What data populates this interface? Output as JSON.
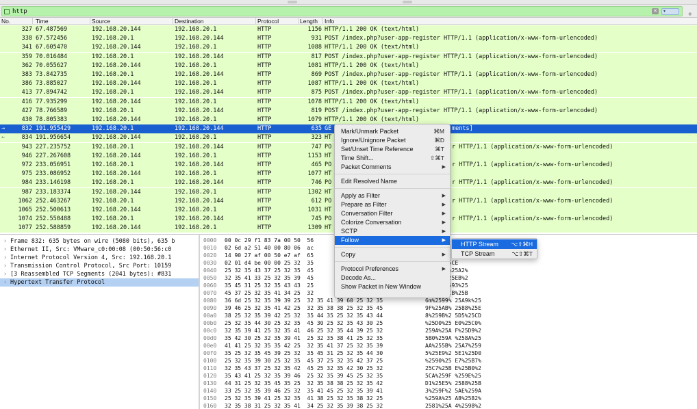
{
  "filter": {
    "value": "http",
    "apply_label": "▾",
    "add_label": "+",
    "clear_label": "✕"
  },
  "columns": [
    "No.",
    "Time",
    "Source",
    "Destination",
    "Protocol",
    "Length",
    "Info"
  ],
  "packets": [
    {
      "mark": "",
      "no": "327",
      "time": "67.487569",
      "src": "192.168.20.144",
      "dst": "192.168.20.1",
      "proto": "HTTP",
      "len": "1156",
      "info": "HTTP/1.1 200 OK  (text/html)"
    },
    {
      "mark": "",
      "no": "338",
      "time": "67.572456",
      "src": "192.168.20.1",
      "dst": "192.168.20.144",
      "proto": "HTTP",
      "len": "931",
      "info": "POST /index.php?user-app-register HTTP/1.1  (application/x-www-form-urlencoded)"
    },
    {
      "mark": "",
      "no": "341",
      "time": "67.605470",
      "src": "192.168.20.144",
      "dst": "192.168.20.1",
      "proto": "HTTP",
      "len": "1088",
      "info": "HTTP/1.1 200 OK  (text/html)"
    },
    {
      "mark": "",
      "no": "359",
      "time": "70.016484",
      "src": "192.168.20.1",
      "dst": "192.168.20.144",
      "proto": "HTTP",
      "len": "817",
      "info": "POST /index.php?user-app-register HTTP/1.1  (application/x-www-form-urlencoded)"
    },
    {
      "mark": "",
      "no": "362",
      "time": "70.055627",
      "src": "192.168.20.144",
      "dst": "192.168.20.1",
      "proto": "HTTP",
      "len": "1081",
      "info": "HTTP/1.1 200 OK  (text/html)"
    },
    {
      "mark": "",
      "no": "383",
      "time": "73.842735",
      "src": "192.168.20.1",
      "dst": "192.168.20.144",
      "proto": "HTTP",
      "len": "869",
      "info": "POST /index.php?user-app-register HTTP/1.1  (application/x-www-form-urlencoded)"
    },
    {
      "mark": "",
      "no": "386",
      "time": "73.885027",
      "src": "192.168.20.144",
      "dst": "192.168.20.1",
      "proto": "HTTP",
      "len": "1087",
      "info": "HTTP/1.1 200 OK  (text/html)"
    },
    {
      "mark": "",
      "no": "413",
      "time": "77.894742",
      "src": "192.168.20.1",
      "dst": "192.168.20.144",
      "proto": "HTTP",
      "len": "875",
      "info": "POST /index.php?user-app-register HTTP/1.1  (application/x-www-form-urlencoded)"
    },
    {
      "mark": "",
      "no": "416",
      "time": "77.935299",
      "src": "192.168.20.144",
      "dst": "192.168.20.1",
      "proto": "HTTP",
      "len": "1078",
      "info": "HTTP/1.1 200 OK  (text/html)"
    },
    {
      "mark": "",
      "no": "427",
      "time": "78.766589",
      "src": "192.168.20.1",
      "dst": "192.168.20.144",
      "proto": "HTTP",
      "len": "819",
      "info": "POST /index.php?user-app-register HTTP/1.1  (application/x-www-form-urlencoded)"
    },
    {
      "mark": "",
      "no": "430",
      "time": "78.805383",
      "src": "192.168.20.144",
      "dst": "192.168.20.1",
      "proto": "HTTP",
      "len": "1079",
      "info": "HTTP/1.1 200 OK  (text/html)"
    },
    {
      "mark": "→",
      "no": "832",
      "time": "191.955429",
      "src": "192.168.20.1",
      "dst": "192.168.20.144",
      "proto": "HTTP",
      "len": "635",
      "info": "GE",
      "info_tail": "ments]",
      "selected": true
    },
    {
      "mark": "←",
      "no": "834",
      "time": "191.956654",
      "src": "192.168.20.144",
      "dst": "192.168.20.1",
      "proto": "HTTP",
      "len": "323",
      "info": "HT"
    },
    {
      "mark": "",
      "no": "943",
      "time": "227.235752",
      "src": "192.168.20.1",
      "dst": "192.168.20.144",
      "proto": "HTTP",
      "len": "747",
      "info": "PO",
      "info_tail": "r HTTP/1.1  (application/x-www-form-urlencoded)"
    },
    {
      "mark": "",
      "no": "946",
      "time": "227.267608",
      "src": "192.168.20.144",
      "dst": "192.168.20.1",
      "proto": "HTTP",
      "len": "1153",
      "info": "HT"
    },
    {
      "mark": "",
      "no": "972",
      "time": "233.056951",
      "src": "192.168.20.1",
      "dst": "192.168.20.144",
      "proto": "HTTP",
      "len": "465",
      "info": "PO",
      "info_tail": "r HTTP/1.1  (application/x-www-form-urlencoded)"
    },
    {
      "mark": "",
      "no": "975",
      "time": "233.086952",
      "src": "192.168.20.144",
      "dst": "192.168.20.1",
      "proto": "HTTP",
      "len": "1077",
      "info": "HT"
    },
    {
      "mark": "",
      "no": "984",
      "time": "233.146198",
      "src": "192.168.20.1",
      "dst": "192.168.20.144",
      "proto": "HTTP",
      "len": "746",
      "info": "PO",
      "info_tail": "r HTTP/1.1  (application/x-www-form-urlencoded)"
    },
    {
      "mark": "",
      "no": "987",
      "time": "233.183374",
      "src": "192.168.20.144",
      "dst": "192.168.20.1",
      "proto": "HTTP",
      "len": "1302",
      "info": "HT"
    },
    {
      "mark": "",
      "no": "1062",
      "time": "252.463267",
      "src": "192.168.20.1",
      "dst": "192.168.20.144",
      "proto": "HTTP",
      "len": "612",
      "info": "PO",
      "info_tail": "r HTTP/1.1  (application/x-www-form-urlencoded)"
    },
    {
      "mark": "",
      "no": "1065",
      "time": "252.500613",
      "src": "192.168.20.144",
      "dst": "192.168.20.1",
      "proto": "HTTP",
      "len": "1031",
      "info": "HT"
    },
    {
      "mark": "",
      "no": "1074",
      "time": "252.550488",
      "src": "192.168.20.1",
      "dst": "192.168.20.144",
      "proto": "HTTP",
      "len": "745",
      "info": "PO",
      "info_tail": "r HTTP/1.1  (application/x-www-form-urlencoded)"
    },
    {
      "mark": "",
      "no": "1077",
      "time": "252.588859",
      "src": "192.168.20.144",
      "dst": "192.168.20.1",
      "proto": "HTTP",
      "len": "1309",
      "info": "HT"
    }
  ],
  "details": [
    {
      "text": "Frame 832: 635 bytes on wire (5080 bits), 635 b"
    },
    {
      "text": "Ethernet II, Src: VMware_c0:00:08 (00:50:56:c0"
    },
    {
      "text": "Internet Protocol Version 4, Src: 192.168.20.1"
    },
    {
      "text": "Transmission Control Protocol, Src Port: 10159"
    },
    {
      "text": "[3 Reassembled TCP Segments (2041 bytes): #831"
    },
    {
      "text": "Hypertext Transfer Protocol",
      "selected": true
    }
  ],
  "bytes": [
    {
      "off": "0000",
      "hex": "00 0c 29 f1 83 7a 00 50  56",
      "asc": ""
    },
    {
      "off": "0010",
      "hex": "02 6d a2 51 40 00 80 06  ac",
      "asc": ""
    },
    {
      "off": "0020",
      "hex": "14 90 27 af 00 50 e7 af  65",
      "asc": ""
    },
    {
      "off": "0030",
      "hex": "02 01 d4 be 00 00 25 32  35",
      "asc": "  5E9%25CE"
    },
    {
      "off": "0040",
      "hex": "25 32 35 43 37 25 32 35  45",
      "asc": "  25 E3%25A2%"
    },
    {
      "off": "0050",
      "hex": "32 35 41 33 25 32 35 39  45",
      "asc": "  59 E%25EB%2"
    },
    {
      "off": "0060",
      "hex": "35 45 31 25 32 35 43 43  25",
      "asc": "  CC %2593%25"
    },
    {
      "off": "0070",
      "hex": "45 37 25 32 35 41 34 25  32",
      "asc": "  A% 25CB%25B"
    },
    {
      "off": "0080",
      "hex": "36 6d 25 32 35 39 39 25  32 35 41 39 60 25 32 35",
      "asc": "6m%2599% 25A9k%25"
    },
    {
      "off": "0090",
      "hex": "39 46 25 32 35 41 42 25  32 35 38 38 25 32 35 45",
      "asc": "9F%25AB% 2588%25E"
    },
    {
      "off": "00a0",
      "hex": "38 25 32 35 39 42 25 32  35 44 35 25 32 35 43 44",
      "asc": "8%259B%2 5D5%25CD"
    },
    {
      "off": "00b0",
      "hex": "25 32 35 44 30 25 32 35  45 30 25 32 35 43 30 25",
      "asc": "%25D0%25 E0%25C0%"
    },
    {
      "off": "00c0",
      "hex": "32 35 39 41 25 32 35 41  46 25 32 35 44 39 25 32",
      "asc": "259A%25A F%25D9%2"
    },
    {
      "off": "00d0",
      "hex": "35 42 30 25 32 35 39 41  25 32 35 38 41 25 32 35",
      "asc": "5B0%259A %258A%25"
    },
    {
      "off": "00e0",
      "hex": "41 41 25 32 35 35 42 25  32 35 41 37 25 32 35 39",
      "asc": "AA%255B% 25A7%259"
    },
    {
      "off": "00f0",
      "hex": "35 25 32 35 45 39 25 32  35 45 31 25 32 35 44 30",
      "asc": "5%25E9%2 5E1%25D0"
    },
    {
      "off": "0100",
      "hex": "25 32 35 39 30 25 32 35  45 37 25 32 35 42 37 25",
      "asc": "%2590%25 E7%25B7%"
    },
    {
      "off": "0110",
      "hex": "32 35 43 37 25 32 35 42  45 25 32 35 42 30 25 32",
      "asc": "25C7%25B E%25B0%2"
    },
    {
      "off": "0120",
      "hex": "35 43 41 25 32 35 39 46  25 32 35 39 45 25 32 35",
      "asc": "5CA%259F %259E%25"
    },
    {
      "off": "0130",
      "hex": "44 31 25 32 35 45 35 25  32 35 38 38 25 32 35 42",
      "asc": "D1%25E5% 2588%25B"
    },
    {
      "off": "0140",
      "hex": "33 25 32 35 39 46 25 32  35 41 45 25 32 35 39 41",
      "asc": "3%259F%2 5AE%259A"
    },
    {
      "off": "0150",
      "hex": "25 32 35 39 41 25 32 35  41 38 25 32 35 38 32 25",
      "asc": "%259A%25 A8%2582%"
    },
    {
      "off": "0160",
      "hex": "32 35 38 31 25 32 35 41  34 25 32 35 39 38 25 32",
      "asc": "2581%25A 4%2598%2"
    }
  ],
  "context_menu": {
    "items": [
      {
        "label": "Mark/Unmark Packet",
        "shortcut": "⌘M"
      },
      {
        "label": "Ignore/Unignore Packet",
        "shortcut": "⌘D"
      },
      {
        "label": "Set/Unset Time Reference",
        "shortcut": "⌘T"
      },
      {
        "label": "Time Shift...",
        "shortcut": "⇧⌘T"
      },
      {
        "label": "Packet Comments",
        "submenu": true
      },
      {
        "sep": true
      },
      {
        "label": "Edit Resolved Name"
      },
      {
        "sep": true
      },
      {
        "label": "Apply as Filter",
        "submenu": true
      },
      {
        "label": "Prepare as Filter",
        "submenu": true
      },
      {
        "label": "Conversation Filter",
        "submenu": true
      },
      {
        "label": "Colorize Conversation",
        "submenu": true
      },
      {
        "label": "SCTP",
        "submenu": true
      },
      {
        "label": "Follow",
        "submenu": true,
        "highlighted": true
      },
      {
        "sep": true
      },
      {
        "label": "Copy",
        "submenu": true
      },
      {
        "sep": true
      },
      {
        "label": "Protocol Preferences",
        "submenu": true
      },
      {
        "label": "Decode As..."
      },
      {
        "label": "Show Packet in New Window"
      }
    ]
  },
  "follow_submenu": [
    {
      "label": "HTTP Stream",
      "shortcut": "⌥⇧⌘H",
      "highlighted": true
    },
    {
      "label": "TCP Stream",
      "shortcut": "⌥⇧⌘T"
    }
  ],
  "colors": {
    "filter_ok": "#b6f2ab",
    "http_row": "#e4ffc7",
    "selection": "#1a5fd0",
    "menu_highlight": "#1a6be0"
  }
}
